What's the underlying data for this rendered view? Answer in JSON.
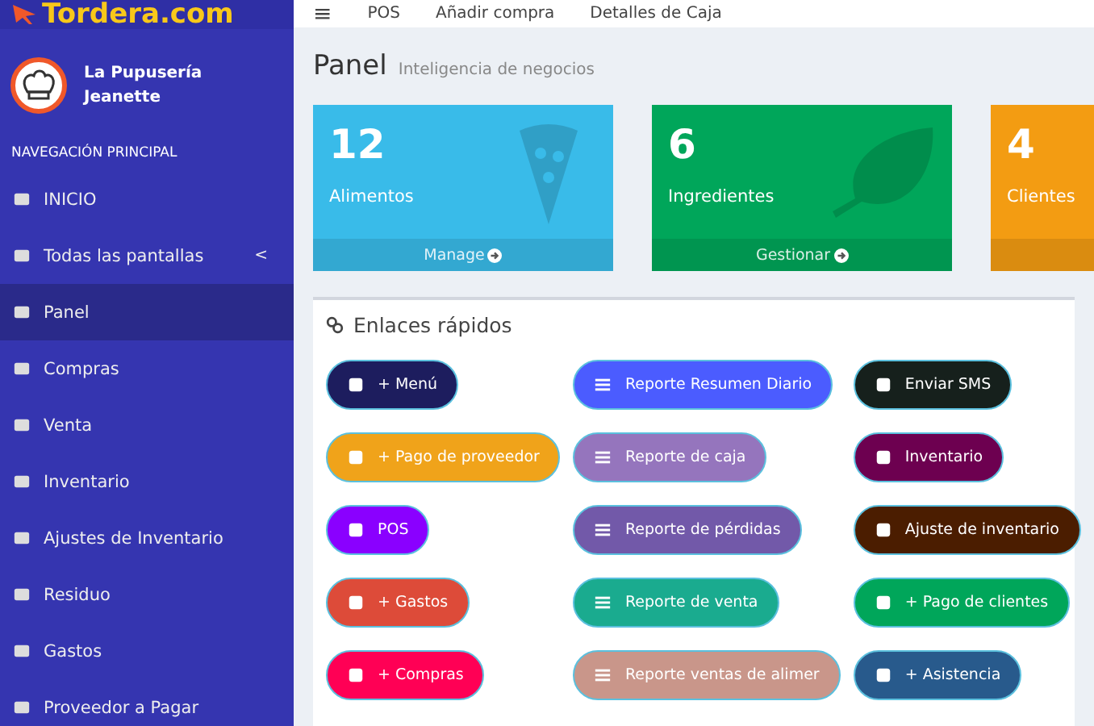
{
  "logo": {
    "text": "Tordera.com"
  },
  "topbar": {
    "menu": "≡",
    "links": [
      "POS",
      "Añadir compra",
      "Detalles de Caja"
    ]
  },
  "user": {
    "name_line_1": "La Pupusería",
    "name_line_2": "Jeanette"
  },
  "sidebar": {
    "header": "NAVEGACIÓN PRINCIPAL",
    "items": [
      {
        "label": "INICIO",
        "selected": false
      },
      {
        "label": "Todas las pantallas",
        "selected": false,
        "caret": "<"
      },
      {
        "label": "Panel",
        "selected": true
      },
      {
        "label": "Compras",
        "selected": false
      },
      {
        "label": "Venta",
        "selected": false
      },
      {
        "label": "Inventario",
        "selected": false
      },
      {
        "label": "Ajustes de Inventario",
        "selected": false
      },
      {
        "label": "Residuo",
        "selected": false
      },
      {
        "label": "Gastos",
        "selected": false
      },
      {
        "label": "Proveedor a Pagar",
        "selected": false
      }
    ]
  },
  "page": {
    "title": "Panel",
    "subtitle": "Inteligencia de negocios"
  },
  "cards": [
    {
      "value": "12",
      "label": "Alimentos",
      "link": "Manage",
      "color": "#39bbe9"
    },
    {
      "value": "6",
      "label": "Ingredientes",
      "link": "Gestionar",
      "color": "#00a65a"
    },
    {
      "value": "4",
      "label": "Clientes",
      "color": "#f39c12"
    }
  ],
  "quick_links": {
    "title": "Enlaces rápidos",
    "columns": [
      [
        {
          "label": "+ Menú",
          "color": "#1d1d5e"
        },
        {
          "label": "+ Pago de proveedor",
          "color": "#f0a31a"
        },
        {
          "label": "POS",
          "color": "#8a00ff"
        },
        {
          "label": "+ Gastos",
          "color": "#dd4b39"
        },
        {
          "label": "+ Compras",
          "color": "#ff0055"
        }
      ],
      [
        {
          "label": "Reporte Resumen Diario",
          "color": "#4b5cff"
        },
        {
          "label": "Reporte de caja",
          "color": "#9575bd"
        },
        {
          "label": "Reporte de pérdidas",
          "color": "#7259a9"
        },
        {
          "label": "Reporte de venta",
          "color": "#1aab8f"
        },
        {
          "label": "Reporte ventas de alimer",
          "color": "#c9968a"
        }
      ],
      [
        {
          "label": "Enviar SMS",
          "color": "#16201c"
        },
        {
          "label": "Inventario",
          "color": "#6d0050"
        },
        {
          "label": "Ajuste de inventario",
          "color": "#4b1d00"
        },
        {
          "label": "+ Pago de clientes",
          "color": "#00a65a"
        },
        {
          "label": "+ Asistencia",
          "color": "#285a8c"
        }
      ]
    ]
  }
}
